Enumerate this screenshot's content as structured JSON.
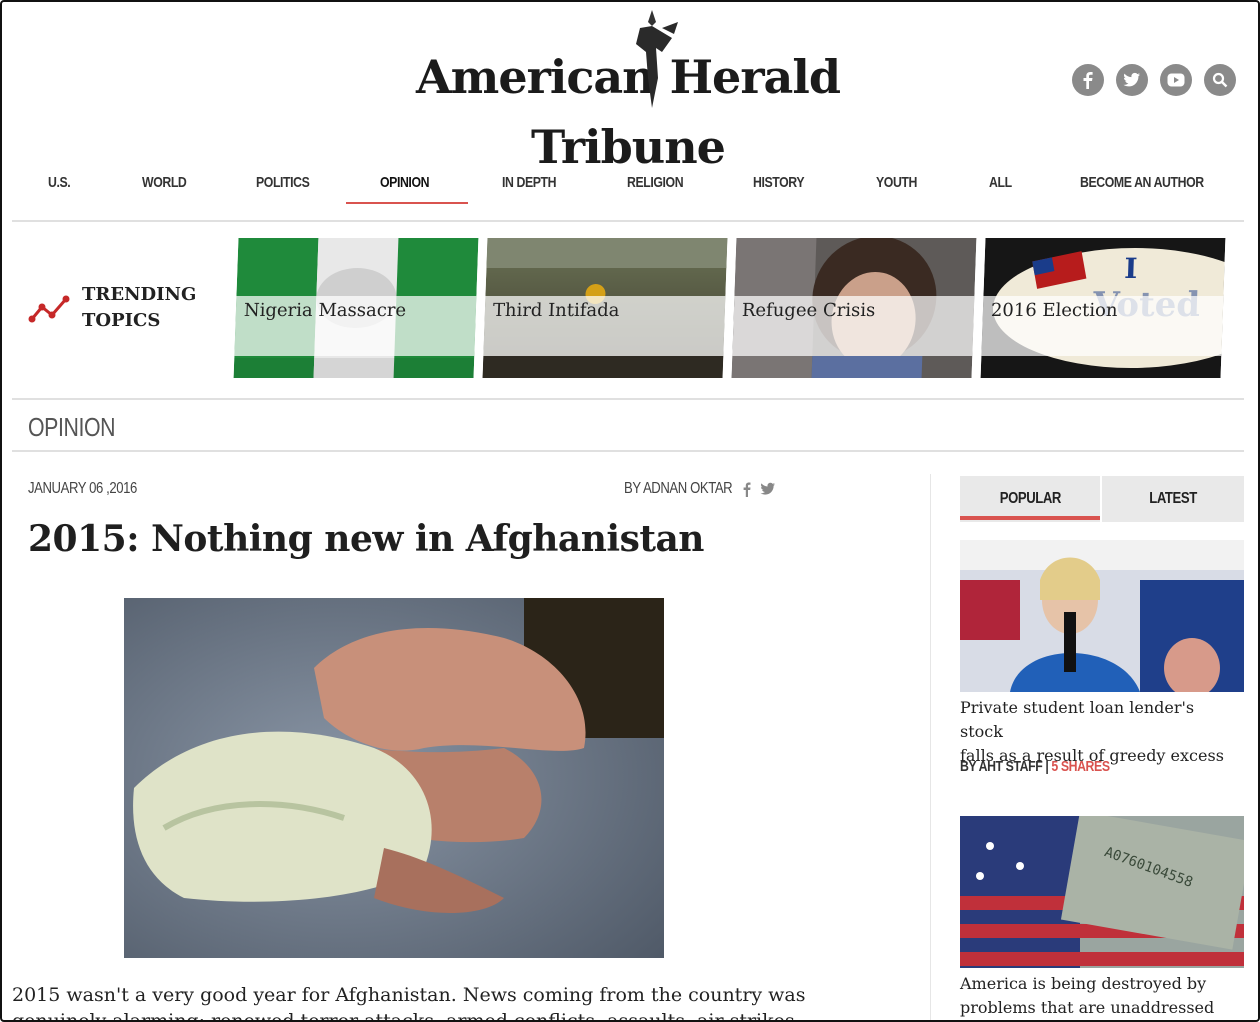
{
  "header": {
    "logo_text": "American Herald Tribune",
    "social": [
      {
        "name": "facebook-icon",
        "glyph": "f"
      },
      {
        "name": "twitter-icon",
        "glyph": "t"
      },
      {
        "name": "youtube-icon",
        "glyph": "yt"
      },
      {
        "name": "search-icon",
        "glyph": "search"
      }
    ]
  },
  "nav": {
    "items": [
      "U.S.",
      "WORLD",
      "POLITICS",
      "OPINION",
      "IN DEPTH",
      "RELIGION",
      "HISTORY",
      "YOUTH",
      "ALL",
      "BECOME AN AUTHOR"
    ],
    "active": "OPINION"
  },
  "trending": {
    "label_line1": "TRENDING",
    "label_line2": "TOPICS",
    "cards": [
      {
        "title": "Nigeria Massacre"
      },
      {
        "title": "Third Intifada"
      },
      {
        "title": "Refugee Crisis"
      },
      {
        "title": "2016 Election"
      }
    ]
  },
  "section": {
    "title": "OPINION"
  },
  "article": {
    "date": "JANUARY 06 ,2016",
    "byline": "BY ADNAN OKTAR",
    "headline": "2015: Nothing new in Afghanistan",
    "lede_line1": "2015 wasn't a very good year for Afghanistan. News coming from the country was",
    "lede_line2": "genuinely alarming: renewed terror attacks, armed conflicts, assaults, air strikes"
  },
  "sidebar": {
    "tabs": [
      "POPULAR",
      "LATEST"
    ],
    "active_tab": "POPULAR",
    "stories": [
      {
        "title_line1": "Private student loan lender's stock",
        "title_line2": "falls as a result of greedy excess",
        "author": "BY AHT STAFF",
        "shares": "5 SHARES"
      },
      {
        "title_line1": "America is being destroyed by",
        "title_line2": "problems that are unaddressed"
      }
    ]
  },
  "colors": {
    "accent": "#d9534f",
    "nav_text": "#333333",
    "icon_bg": "#8a8a8a"
  }
}
